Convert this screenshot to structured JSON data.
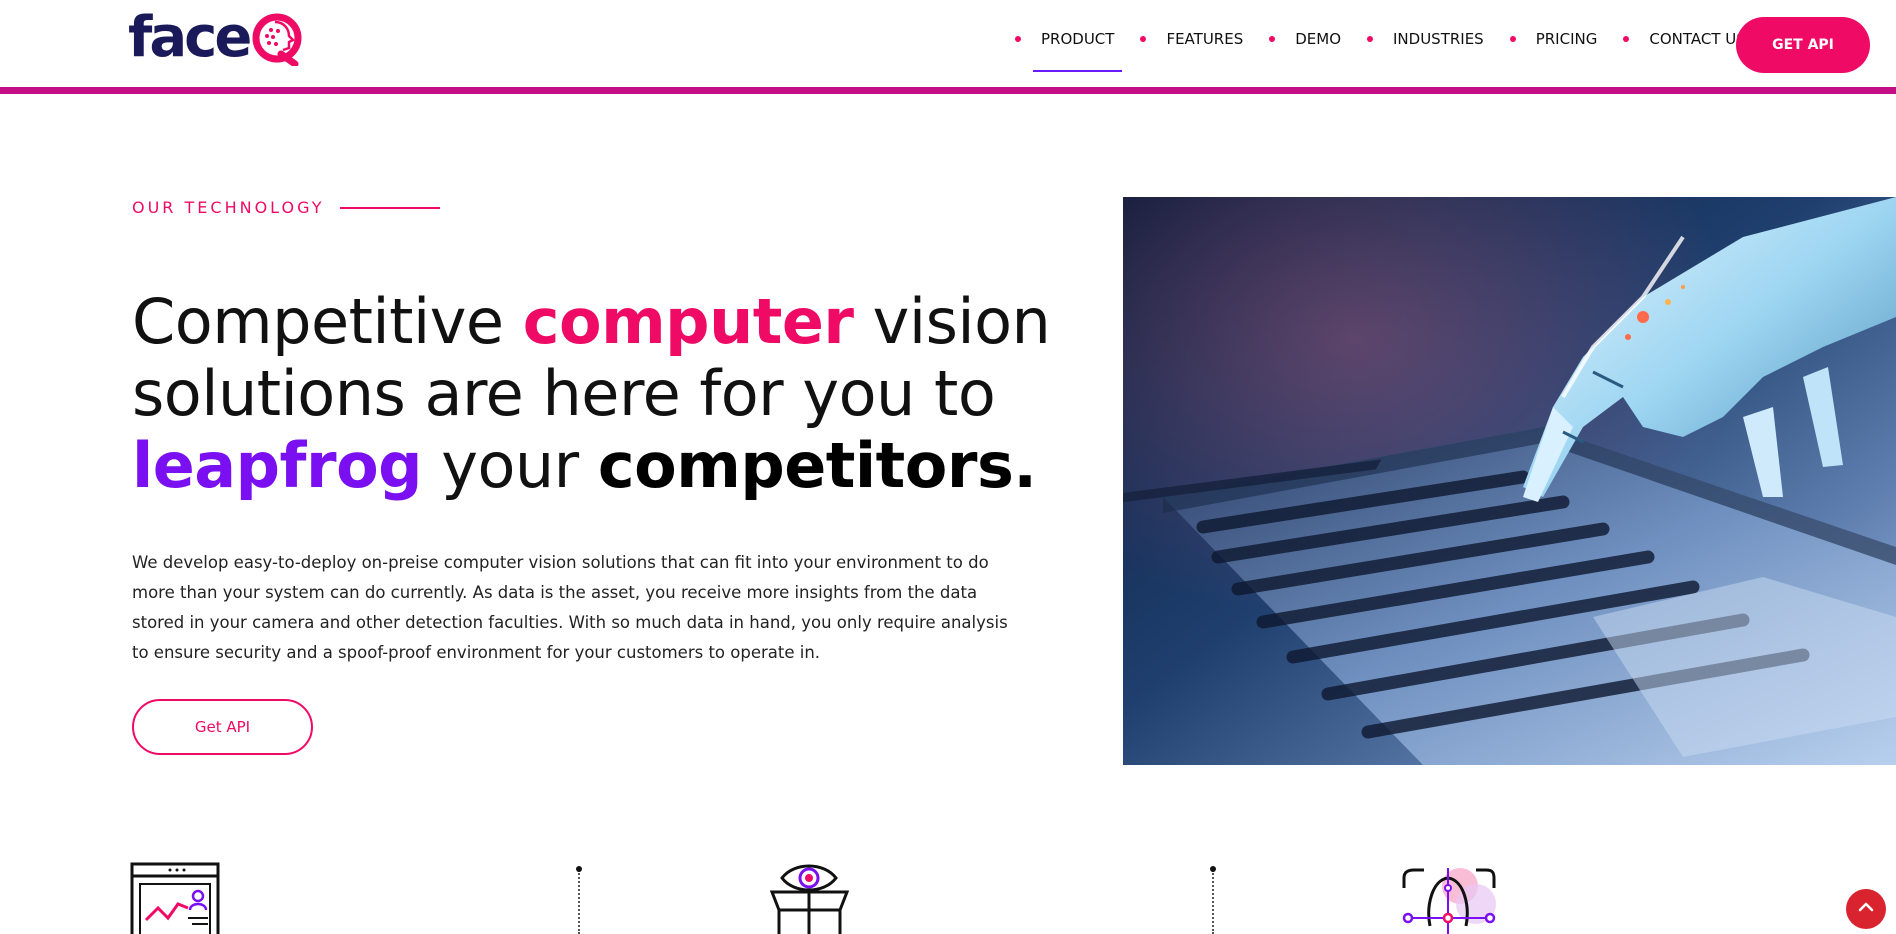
{
  "header": {
    "logo_text": "face",
    "logo_mark": "Q",
    "nav": [
      {
        "label": "PRODUCT",
        "active": true
      },
      {
        "label": "FEATURES",
        "active": false
      },
      {
        "label": "DEMO",
        "active": false
      },
      {
        "label": "INDUSTRIES",
        "active": false
      },
      {
        "label": "PRICING",
        "active": false
      },
      {
        "label": "CONTACT US",
        "active": false
      }
    ],
    "cta_label": "GET API"
  },
  "hero": {
    "eyebrow": "OUR TECHNOLOGY",
    "headline": {
      "part1": "Competitive ",
      "highlight1": "computer",
      "part2": " vision solutions are here for you to ",
      "highlight2": "leapfrog",
      "part3": " your ",
      "highlight3": "competitors."
    },
    "description": "We develop easy-to-deploy on-preise computer vision solutions that can fit into your environment to do more than your system can do currently. As data is the asset, you receive more insights from the data stored in your camera and other detection faculties. With so much data in hand, you only require analysis to ensure security and a spoof-proof environment for your customers to operate in.",
    "button_label": "Get API",
    "image": "robot-hand-typing-on-laptop"
  },
  "features": {
    "icons": [
      "analytics-dashboard-icon",
      "eye-in-box-icon",
      "face-recognition-icon"
    ]
  },
  "colors": {
    "pink": "#ef0a66",
    "purple": "#7a10f2",
    "magenta_bar": "#c40e85",
    "navy_logo": "#1a1a5a",
    "scroll_button": "#d9232e"
  }
}
